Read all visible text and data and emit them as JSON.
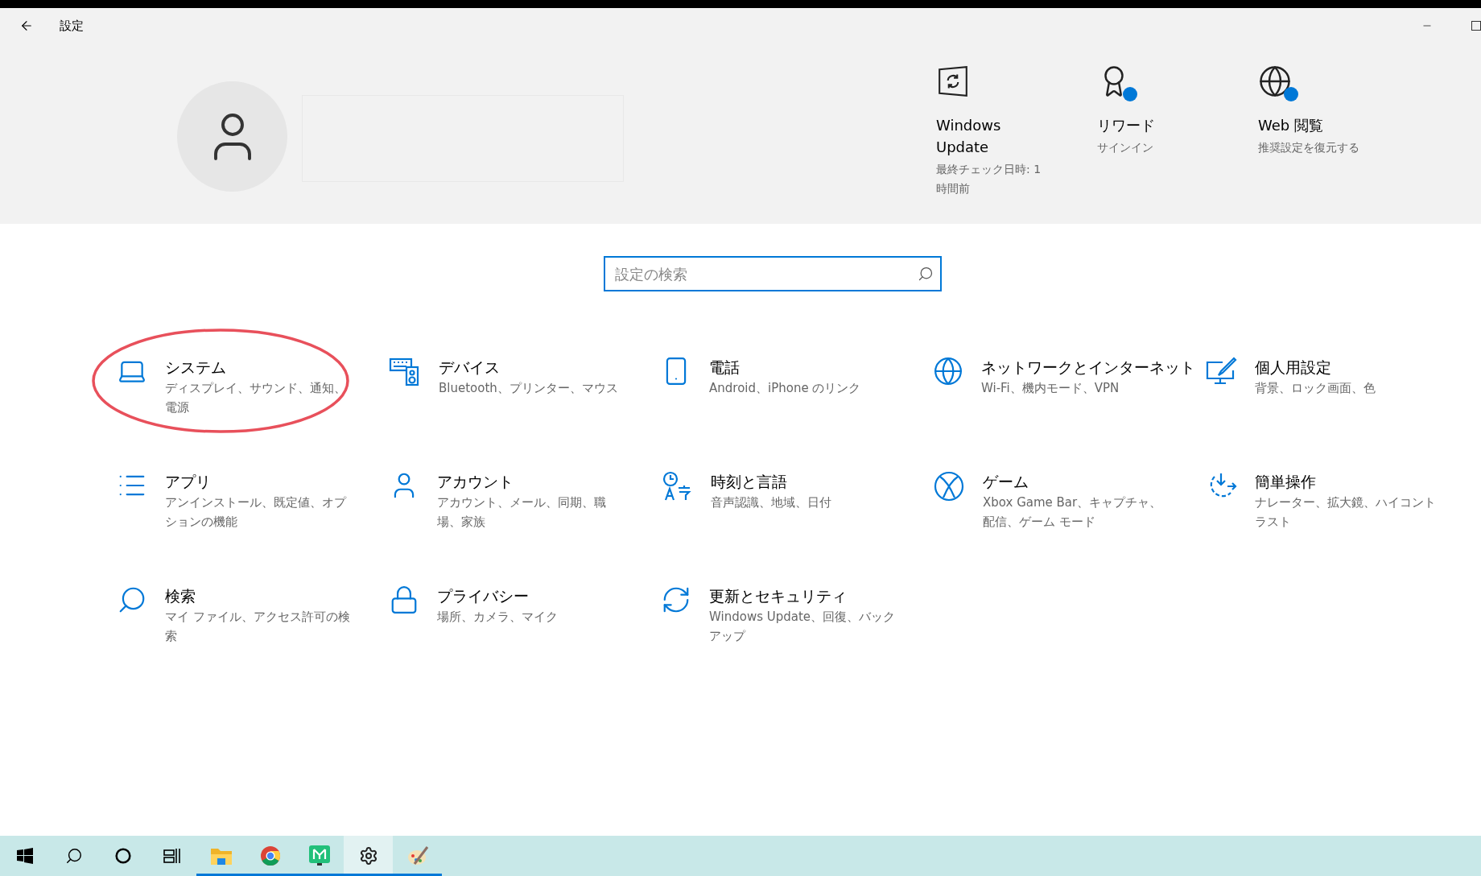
{
  "window": {
    "title": "設定"
  },
  "header": {
    "items": [
      {
        "kind": "update",
        "title": "Windows Update",
        "description": "最終チェック日時: 1 時間前",
        "notification": false
      },
      {
        "kind": "rewards",
        "title": "リワード",
        "description": "サインイン",
        "notification": true
      },
      {
        "kind": "web",
        "title": "Web 閲覧",
        "description": "推奨設定を復元する",
        "notification": true
      }
    ]
  },
  "search": {
    "placeholder": "設定の検索"
  },
  "categories": [
    {
      "kind": "system",
      "title": "システム",
      "description": "ディスプレイ、サウンド、通知、電源",
      "highlighted": true
    },
    {
      "kind": "devices",
      "title": "デバイス",
      "description": "Bluetooth、プリンター、マウス",
      "highlighted": false
    },
    {
      "kind": "phone",
      "title": "電話",
      "description": "Android、iPhone のリンク",
      "highlighted": false
    },
    {
      "kind": "network",
      "title": "ネットワークとインターネット",
      "description": "Wi-Fi、機内モード、VPN",
      "highlighted": false
    },
    {
      "kind": "personalization",
      "title": "個人用設定",
      "description": "背景、ロック画面、色",
      "highlighted": false
    },
    {
      "kind": "apps",
      "title": "アプリ",
      "description": "アンインストール、既定値、オプションの機能",
      "highlighted": false
    },
    {
      "kind": "accounts",
      "title": "アカウント",
      "description": "アカウント、メール、同期、職場、家族",
      "highlighted": false
    },
    {
      "kind": "time",
      "title": "時刻と言語",
      "description": "音声認識、地域、日付",
      "highlighted": false
    },
    {
      "kind": "gaming",
      "title": "ゲーム",
      "description": "Xbox Game Bar、キャプチャ、配信、ゲーム モード",
      "highlighted": false
    },
    {
      "kind": "ease",
      "title": "簡単操作",
      "description": "ナレーター、拡大鏡、ハイコントラスト",
      "highlighted": false
    },
    {
      "kind": "search",
      "title": "検索",
      "description": "マイ ファイル、アクセス許可の検索",
      "highlighted": false
    },
    {
      "kind": "privacy",
      "title": "プライバシー",
      "description": "場所、カメラ、マイク",
      "highlighted": false
    },
    {
      "kind": "update",
      "title": "更新とセキュリティ",
      "description": "Windows Update、回復、バックアップ",
      "highlighted": false
    }
  ],
  "taskbar": {
    "items": [
      {
        "kind": "start",
        "running": false,
        "selected": false
      },
      {
        "kind": "search",
        "running": false,
        "selected": false
      },
      {
        "kind": "cortana",
        "running": false,
        "selected": false
      },
      {
        "kind": "taskview",
        "running": false,
        "selected": false
      },
      {
        "kind": "explorer",
        "running": true,
        "selected": false
      },
      {
        "kind": "chrome",
        "running": true,
        "selected": false
      },
      {
        "kind": "greenapp",
        "running": true,
        "selected": false
      },
      {
        "kind": "settings",
        "running": true,
        "selected": true
      },
      {
        "kind": "paint",
        "running": true,
        "selected": false
      }
    ]
  }
}
